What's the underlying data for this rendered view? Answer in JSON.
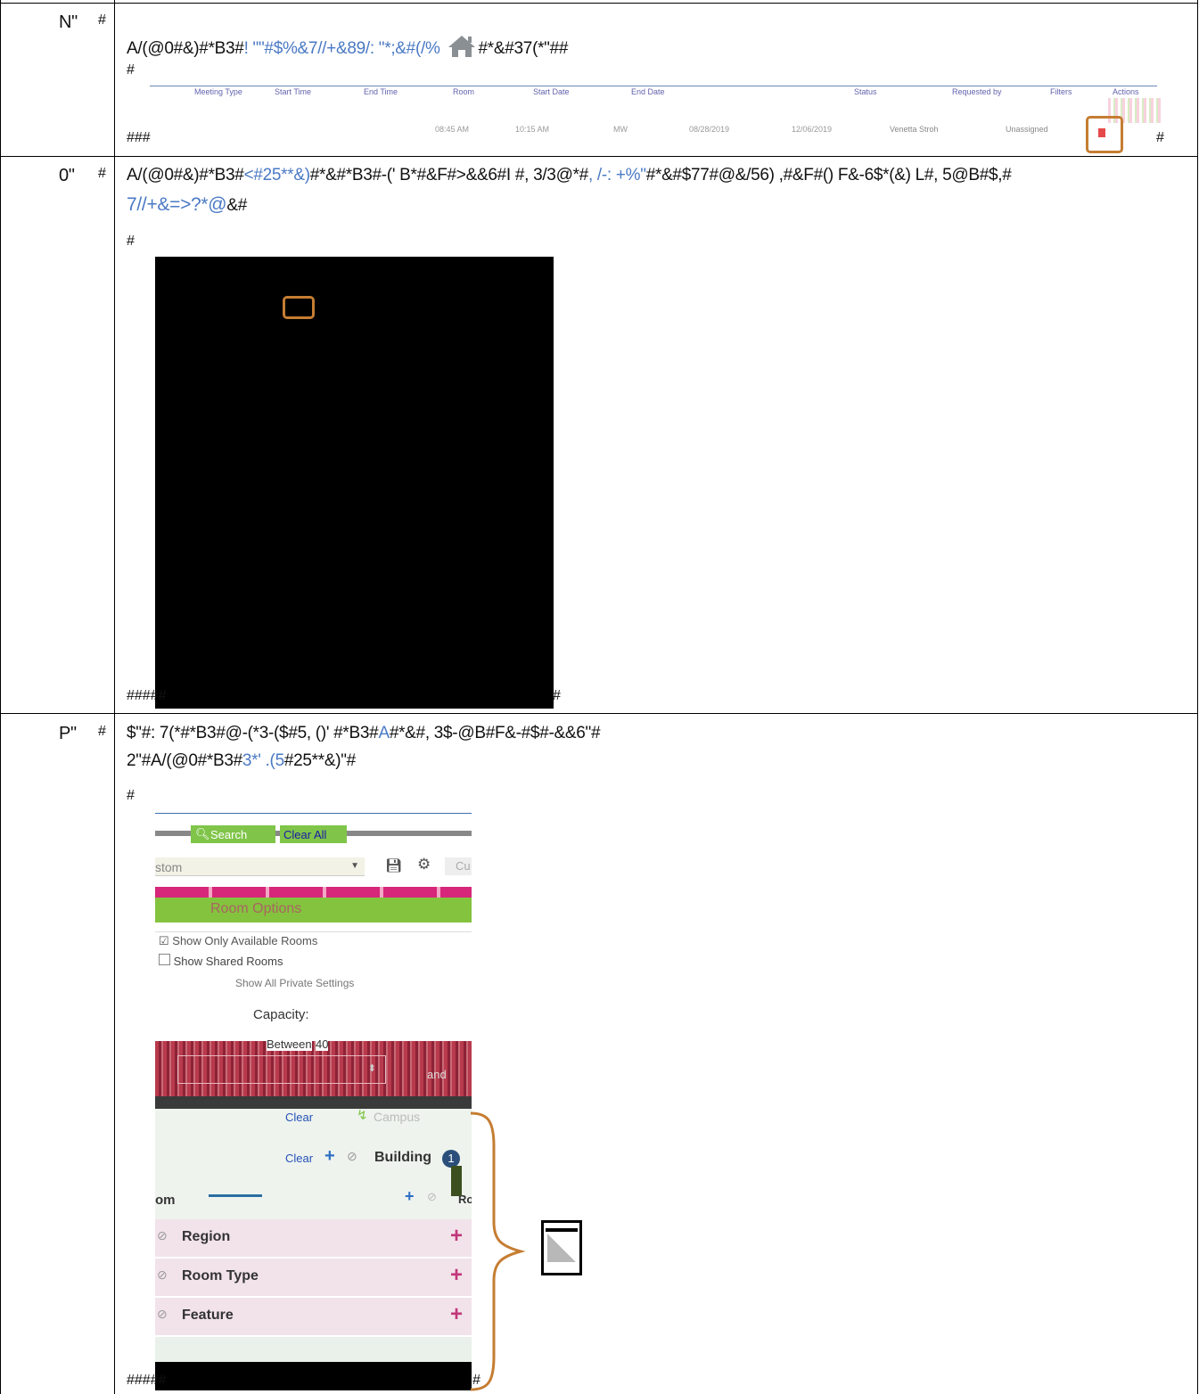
{
  "rows": [
    {
      "number": "N\"",
      "hash_marker": "#",
      "line1_black": "A/(@0#&)#*B3#",
      "line1_blue": "! \"\"#$%&7//+&89/: \"*;&#(/%",
      "line1_tail": "#*&#37(*\"##",
      "blank_hash": "#",
      "end_hash_left": "###",
      "end_hash_right": "#",
      "ui_strip": {
        "headers": [
          "",
          "Meeting Type",
          "Start Time",
          "End Time",
          "Room",
          "Start Date",
          "End Date",
          "",
          "Status",
          "Requested by",
          "Filters",
          "Actions"
        ],
        "row_values": [
          "08:45 AM",
          "10:15 AM",
          "MW",
          "08/28/2019",
          "12/06/2019",
          "Venetta Stroh",
          "Unassigned"
        ]
      }
    },
    {
      "number": "0\"",
      "hash_marker": "#",
      "line1_black_a": "A/(@0#&)#*B3#",
      "line1_blue_a": "<#25**&)",
      "line1_black_b": "#*&#*B3#-(' B*#&F#>&&6#I #, 3/3@*#",
      "line1_blue_b": ", /-: +%\"",
      "line1_black_c": "#*&#$77#@&/56) ,#&F#() F&-6$*(&) L#, 5@B#$,#",
      "line2_blue": "7//+&=>?*@",
      "line2_black": "&#",
      "blank_hash": "#",
      "end_hash": "#####",
      "end_hash_right": "#"
    },
    {
      "number": "P\"",
      "hash_marker": "#",
      "line1_black_a": "$\"#: 7(*#*B3#@-(*3-($#5, ()' #*B3#",
      "line1_blue": "A",
      "line1_black_b": "#*&#, 3$-@B#F&-#$#-&&6\"#",
      "line2_black_a": "2\"#A/(@0#*B3#",
      "line2_blue": "3*' .(5",
      "line2_black_b": "#25**&)\"#",
      "blank_hash": "#",
      "end_hash": "#####",
      "end_hash_right": "#",
      "panel": {
        "search_label": "Search",
        "clear_all_label": "Clear All",
        "custom_value": "stom",
        "cu_label": "Cu",
        "room_options_label": "Room Options",
        "show_only_available": "Show Only Available Rooms",
        "show_shared": "Show Shared Rooms",
        "show_all": "Show All Private Settings",
        "capacity_label": "Capacity:",
        "between_label": "Between",
        "between_value": "40",
        "and_label": "and",
        "clear_label_1": "Clear",
        "campus_label": "Campus",
        "clear_label_2": "Clear",
        "building_label": "Building",
        "building_count": "1",
        "room_fragment": "om",
        "room_fragment_right": "Ro",
        "filters": [
          "Region",
          "Room Type",
          "Feature"
        ]
      }
    }
  ]
}
